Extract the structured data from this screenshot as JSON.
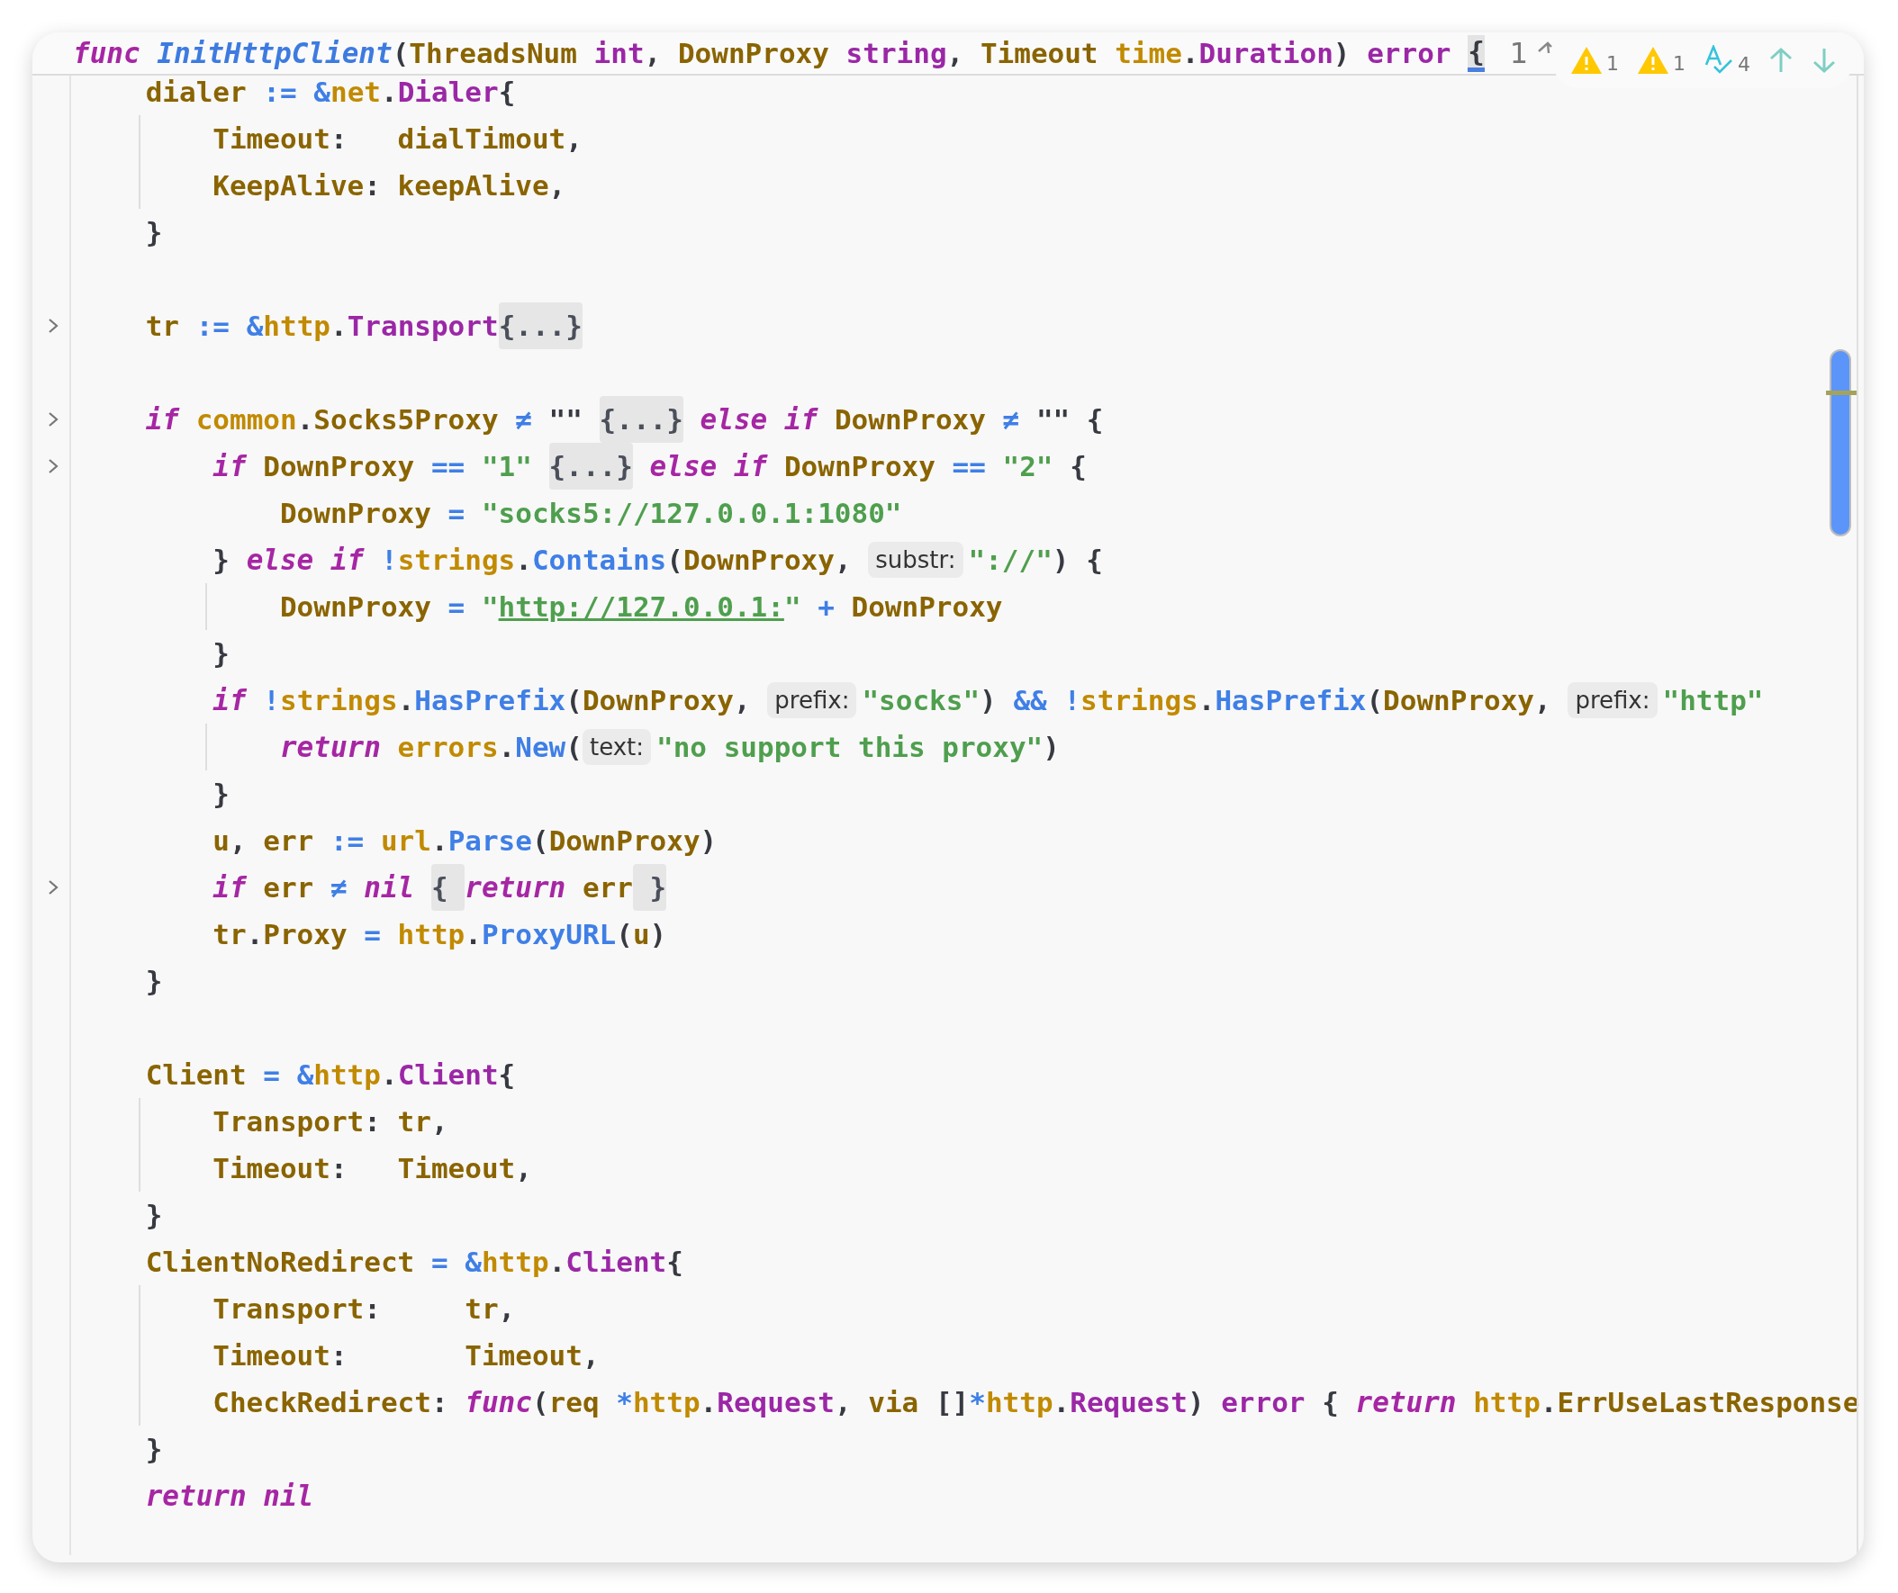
{
  "sticky_header": {
    "tokens": [
      {
        "kind": "kw",
        "text": "func "
      },
      {
        "kind": "fn",
        "text": "InitHttpClient"
      },
      {
        "kind": "plain",
        "text": "("
      },
      {
        "kind": "var",
        "text": "ThreadsNum "
      },
      {
        "kind": "type",
        "text": "int"
      },
      {
        "kind": "plain",
        "text": ", "
      },
      {
        "kind": "var",
        "text": "DownProxy "
      },
      {
        "kind": "type",
        "text": "string"
      },
      {
        "kind": "plain",
        "text": ", "
      },
      {
        "kind": "var",
        "text": "Timeout "
      },
      {
        "kind": "pkg",
        "text": "time"
      },
      {
        "kind": "plain",
        "text": "."
      },
      {
        "kind": "type",
        "text": "Duration"
      },
      {
        "kind": "plain",
        "text": ") "
      },
      {
        "kind": "type",
        "text": "error "
      },
      {
        "kind": "brace",
        "text": "{"
      }
    ]
  },
  "inspection_widget": {
    "count": "1",
    "items": [
      {
        "kind": "warning",
        "count": "1"
      },
      {
        "kind": "warning",
        "count": "1"
      },
      {
        "kind": "typo",
        "count": "4"
      }
    ]
  },
  "lines": [
    {
      "kind": "code",
      "fold": false,
      "guide": true,
      "tokens": [
        {
          "kind": "var",
          "text": "dialer "
        },
        {
          "kind": "op",
          "text": ":= "
        },
        {
          "kind": "op",
          "text": "&"
        },
        {
          "kind": "pkg",
          "text": "net"
        },
        {
          "kind": "plain",
          "text": "."
        },
        {
          "kind": "type",
          "text": "Dialer"
        },
        {
          "kind": "plain",
          "text": "{"
        }
      ],
      "children": [
        {
          "kind": "code",
          "fold": false,
          "tokens": [
            {
              "kind": "var",
              "text": "Timeout"
            },
            {
              "kind": "plain",
              "text": ":   "
            },
            {
              "kind": "var",
              "text": "dialTimout"
            },
            {
              "kind": "plain",
              "text": ","
            }
          ]
        },
        {
          "kind": "code",
          "fold": false,
          "tokens": [
            {
              "kind": "var",
              "text": "KeepAlive"
            },
            {
              "kind": "plain",
              "text": ": "
            },
            {
              "kind": "var",
              "text": "keepAlive"
            },
            {
              "kind": "plain",
              "text": ","
            }
          ]
        }
      ]
    },
    {
      "kind": "code",
      "fold": false,
      "tokens": [
        {
          "kind": "plain",
          "text": "}"
        }
      ]
    },
    {
      "kind": "blank"
    },
    {
      "kind": "code",
      "fold": true,
      "tokens": [
        {
          "kind": "var",
          "text": "tr "
        },
        {
          "kind": "op",
          "text": ":= "
        },
        {
          "kind": "op",
          "text": "&"
        },
        {
          "kind": "pkg",
          "text": "http"
        },
        {
          "kind": "plain",
          "text": "."
        },
        {
          "kind": "type",
          "text": "Transport"
        },
        {
          "kind": "fold",
          "text": "{...}"
        }
      ]
    },
    {
      "kind": "blank"
    },
    {
      "kind": "code",
      "fold": true,
      "guide": false,
      "tokens": [
        {
          "kind": "kw",
          "text": "if "
        },
        {
          "kind": "pkg",
          "text": "common"
        },
        {
          "kind": "plain",
          "text": "."
        },
        {
          "kind": "var",
          "text": "Socks5Proxy "
        },
        {
          "kind": "op",
          "text": "≠ "
        },
        {
          "kind": "plain",
          "text": "\"\" "
        },
        {
          "kind": "fold",
          "text": "{...}"
        },
        {
          "kind": "kw",
          "text": " else "
        },
        {
          "kind": "kw",
          "text": "if "
        },
        {
          "kind": "var",
          "text": "DownProxy "
        },
        {
          "kind": "op",
          "text": "≠ "
        },
        {
          "kind": "plain",
          "text": "\"\" {"
        }
      ],
      "children": [
        {
          "kind": "code",
          "fold": true,
          "guide": false,
          "tokens": [
            {
              "kind": "kw",
              "text": "if "
            },
            {
              "kind": "var",
              "text": "DownProxy "
            },
            {
              "kind": "op",
              "text": "== "
            },
            {
              "kind": "str",
              "text": "\"1\" "
            },
            {
              "kind": "fold",
              "text": "{...}"
            },
            {
              "kind": "kw",
              "text": " else "
            },
            {
              "kind": "kw",
              "text": "if "
            },
            {
              "kind": "var",
              "text": "DownProxy "
            },
            {
              "kind": "op",
              "text": "== "
            },
            {
              "kind": "str",
              "text": "\"2\" "
            },
            {
              "kind": "plain",
              "text": "{"
            }
          ],
          "children": [
            {
              "kind": "code",
              "fold": false,
              "tokens": [
                {
                  "kind": "var",
                  "text": "DownProxy "
                },
                {
                  "kind": "op",
                  "text": "= "
                },
                {
                  "kind": "str",
                  "text": "\"socks5://127.0.0.1:1080\""
                }
              ]
            }
          ]
        },
        {
          "kind": "code",
          "fold": false,
          "guide": true,
          "tokens": [
            {
              "kind": "plain",
              "text": "} "
            },
            {
              "kind": "kw",
              "text": "else "
            },
            {
              "kind": "kw",
              "text": "if "
            },
            {
              "kind": "op",
              "text": "!"
            },
            {
              "kind": "pkg",
              "text": "strings"
            },
            {
              "kind": "plain",
              "text": "."
            },
            {
              "kind": "method",
              "text": "Contains"
            },
            {
              "kind": "plain",
              "text": "("
            },
            {
              "kind": "var",
              "text": "DownProxy"
            },
            {
              "kind": "plain",
              "text": ", "
            },
            {
              "kind": "hint",
              "text": "substr:"
            },
            {
              "kind": "str",
              "text": "\"://\""
            },
            {
              "kind": "plain",
              "text": ") {"
            }
          ],
          "children": [
            {
              "kind": "code",
              "fold": false,
              "tokens": [
                {
                  "kind": "var",
                  "text": "DownProxy "
                },
                {
                  "kind": "op",
                  "text": "= "
                },
                {
                  "kind": "str",
                  "text": "\""
                },
                {
                  "kind": "link",
                  "text": "http://127.0.0.1:"
                },
                {
                  "kind": "str",
                  "text": "\" "
                },
                {
                  "kind": "op",
                  "text": "+ "
                },
                {
                  "kind": "var",
                  "text": "DownProxy"
                }
              ]
            }
          ]
        },
        {
          "kind": "code",
          "fold": false,
          "tokens": [
            {
              "kind": "plain",
              "text": "}"
            }
          ]
        },
        {
          "kind": "code",
          "fold": false,
          "guide": true,
          "tokens": [
            {
              "kind": "kw",
              "text": "if "
            },
            {
              "kind": "op",
              "text": "!"
            },
            {
              "kind": "pkg",
              "text": "strings"
            },
            {
              "kind": "plain",
              "text": "."
            },
            {
              "kind": "method",
              "text": "HasPrefix"
            },
            {
              "kind": "plain",
              "text": "("
            },
            {
              "kind": "var",
              "text": "DownProxy"
            },
            {
              "kind": "plain",
              "text": ", "
            },
            {
              "kind": "hint",
              "text": "prefix:"
            },
            {
              "kind": "str",
              "text": "\"socks\""
            },
            {
              "kind": "plain",
              "text": ") "
            },
            {
              "kind": "op",
              "text": "&& "
            },
            {
              "kind": "op",
              "text": "!"
            },
            {
              "kind": "pkg",
              "text": "strings"
            },
            {
              "kind": "plain",
              "text": "."
            },
            {
              "kind": "method",
              "text": "HasPrefix"
            },
            {
              "kind": "plain",
              "text": "("
            },
            {
              "kind": "var",
              "text": "DownProxy"
            },
            {
              "kind": "plain",
              "text": ", "
            },
            {
              "kind": "hint",
              "text": "prefix:"
            },
            {
              "kind": "str",
              "text": "\"http\""
            }
          ],
          "children": [
            {
              "kind": "code",
              "fold": false,
              "tokens": [
                {
                  "kind": "kw",
                  "text": "return "
                },
                {
                  "kind": "pkg",
                  "text": "errors"
                },
                {
                  "kind": "plain",
                  "text": "."
                },
                {
                  "kind": "method",
                  "text": "New"
                },
                {
                  "kind": "plain",
                  "text": "("
                },
                {
                  "kind": "hint",
                  "text": "text:"
                },
                {
                  "kind": "str",
                  "text": "\"no support this proxy\""
                },
                {
                  "kind": "plain",
                  "text": ")"
                }
              ]
            }
          ]
        },
        {
          "kind": "code",
          "fold": false,
          "tokens": [
            {
              "kind": "plain",
              "text": "}"
            }
          ]
        },
        {
          "kind": "code",
          "fold": false,
          "tokens": [
            {
              "kind": "var",
              "text": "u"
            },
            {
              "kind": "plain",
              "text": ", "
            },
            {
              "kind": "var",
              "text": "err "
            },
            {
              "kind": "op",
              "text": ":= "
            },
            {
              "kind": "pkg",
              "text": "url"
            },
            {
              "kind": "plain",
              "text": "."
            },
            {
              "kind": "method",
              "text": "Parse"
            },
            {
              "kind": "plain",
              "text": "("
            },
            {
              "kind": "var",
              "text": "DownProxy"
            },
            {
              "kind": "plain",
              "text": ")"
            }
          ]
        },
        {
          "kind": "code",
          "fold": true,
          "tokens": [
            {
              "kind": "kw",
              "text": "if "
            },
            {
              "kind": "var",
              "text": "err "
            },
            {
              "kind": "op",
              "text": "≠ "
            },
            {
              "kind": "kw",
              "text": "nil "
            },
            {
              "kind": "fold",
              "text": "{ "
            },
            {
              "kind": "kw",
              "text": "return "
            },
            {
              "kind": "var",
              "text": "err"
            },
            {
              "kind": "fold",
              "text": " }"
            }
          ]
        },
        {
          "kind": "code",
          "fold": false,
          "tokens": [
            {
              "kind": "var",
              "text": "tr"
            },
            {
              "kind": "plain",
              "text": "."
            },
            {
              "kind": "var",
              "text": "Proxy "
            },
            {
              "kind": "op",
              "text": "= "
            },
            {
              "kind": "pkg",
              "text": "http"
            },
            {
              "kind": "plain",
              "text": "."
            },
            {
              "kind": "method",
              "text": "ProxyURL"
            },
            {
              "kind": "plain",
              "text": "("
            },
            {
              "kind": "var",
              "text": "u"
            },
            {
              "kind": "plain",
              "text": ")"
            }
          ]
        }
      ]
    },
    {
      "kind": "code",
      "fold": false,
      "tokens": [
        {
          "kind": "plain",
          "text": "}"
        }
      ]
    },
    {
      "kind": "blank"
    },
    {
      "kind": "code",
      "fold": false,
      "guide": true,
      "tokens": [
        {
          "kind": "var",
          "text": "Client "
        },
        {
          "kind": "op",
          "text": "= "
        },
        {
          "kind": "op",
          "text": "&"
        },
        {
          "kind": "pkg",
          "text": "http"
        },
        {
          "kind": "plain",
          "text": "."
        },
        {
          "kind": "type",
          "text": "Client"
        },
        {
          "kind": "plain",
          "text": "{"
        }
      ],
      "children": [
        {
          "kind": "code",
          "fold": false,
          "tokens": [
            {
              "kind": "var",
              "text": "Transport"
            },
            {
              "kind": "plain",
              "text": ": "
            },
            {
              "kind": "var",
              "text": "tr"
            },
            {
              "kind": "plain",
              "text": ","
            }
          ]
        },
        {
          "kind": "code",
          "fold": false,
          "tokens": [
            {
              "kind": "var",
              "text": "Timeout"
            },
            {
              "kind": "plain",
              "text": ":   "
            },
            {
              "kind": "var",
              "text": "Timeout"
            },
            {
              "kind": "plain",
              "text": ","
            }
          ]
        }
      ]
    },
    {
      "kind": "code",
      "fold": false,
      "tokens": [
        {
          "kind": "plain",
          "text": "}"
        }
      ]
    },
    {
      "kind": "code",
      "fold": false,
      "guide": true,
      "tokens": [
        {
          "kind": "var",
          "text": "ClientNoRedirect "
        },
        {
          "kind": "op",
          "text": "= "
        },
        {
          "kind": "op",
          "text": "&"
        },
        {
          "kind": "pkg",
          "text": "http"
        },
        {
          "kind": "plain",
          "text": "."
        },
        {
          "kind": "type",
          "text": "Client"
        },
        {
          "kind": "plain",
          "text": "{"
        }
      ],
      "children": [
        {
          "kind": "code",
          "fold": false,
          "tokens": [
            {
              "kind": "var",
              "text": "Transport"
            },
            {
              "kind": "plain",
              "text": ":     "
            },
            {
              "kind": "var",
              "text": "tr"
            },
            {
              "kind": "plain",
              "text": ","
            }
          ]
        },
        {
          "kind": "code",
          "fold": false,
          "tokens": [
            {
              "kind": "var",
              "text": "Timeout"
            },
            {
              "kind": "plain",
              "text": ":       "
            },
            {
              "kind": "var",
              "text": "Timeout"
            },
            {
              "kind": "plain",
              "text": ","
            }
          ]
        },
        {
          "kind": "code",
          "fold": false,
          "tokens": [
            {
              "kind": "var",
              "text": "CheckRedirect"
            },
            {
              "kind": "plain",
              "text": ": "
            },
            {
              "kind": "kw",
              "text": "func"
            },
            {
              "kind": "plain",
              "text": "("
            },
            {
              "kind": "var",
              "text": "req "
            },
            {
              "kind": "op",
              "text": "*"
            },
            {
              "kind": "pkg",
              "text": "http"
            },
            {
              "kind": "plain",
              "text": "."
            },
            {
              "kind": "type",
              "text": "Request"
            },
            {
              "kind": "plain",
              "text": ", "
            },
            {
              "kind": "var",
              "text": "via "
            },
            {
              "kind": "plain",
              "text": "[]"
            },
            {
              "kind": "op",
              "text": "*"
            },
            {
              "kind": "pkg",
              "text": "http"
            },
            {
              "kind": "plain",
              "text": "."
            },
            {
              "kind": "type",
              "text": "Request"
            },
            {
              "kind": "plain",
              "text": ") "
            },
            {
              "kind": "type",
              "text": "error "
            },
            {
              "kind": "plain",
              "text": "{ "
            },
            {
              "kind": "kw",
              "text": "return "
            },
            {
              "kind": "pkg",
              "text": "http"
            },
            {
              "kind": "plain",
              "text": "."
            },
            {
              "kind": "var",
              "text": "ErrUseLastResponse"
            }
          ]
        }
      ]
    },
    {
      "kind": "code",
      "fold": false,
      "tokens": [
        {
          "kind": "plain",
          "text": "}"
        }
      ]
    },
    {
      "kind": "code",
      "fold": false,
      "tokens": [
        {
          "kind": "kw",
          "text": "return "
        },
        {
          "kind": "kw",
          "text": "nil"
        }
      ]
    }
  ]
}
